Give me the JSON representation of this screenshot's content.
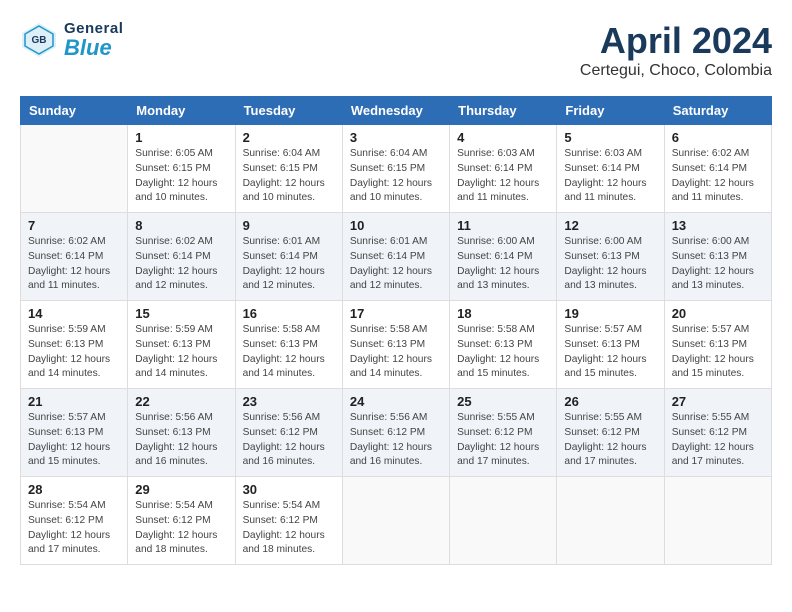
{
  "header": {
    "logo_general": "General",
    "logo_blue": "Blue",
    "month_title": "April 2024",
    "location": "Certegui, Choco, Colombia"
  },
  "calendar": {
    "days_of_week": [
      "Sunday",
      "Monday",
      "Tuesday",
      "Wednesday",
      "Thursday",
      "Friday",
      "Saturday"
    ],
    "weeks": [
      [
        {
          "day": "",
          "info": ""
        },
        {
          "day": "1",
          "info": "Sunrise: 6:05 AM\nSunset: 6:15 PM\nDaylight: 12 hours\nand 10 minutes."
        },
        {
          "day": "2",
          "info": "Sunrise: 6:04 AM\nSunset: 6:15 PM\nDaylight: 12 hours\nand 10 minutes."
        },
        {
          "day": "3",
          "info": "Sunrise: 6:04 AM\nSunset: 6:15 PM\nDaylight: 12 hours\nand 10 minutes."
        },
        {
          "day": "4",
          "info": "Sunrise: 6:03 AM\nSunset: 6:14 PM\nDaylight: 12 hours\nand 11 minutes."
        },
        {
          "day": "5",
          "info": "Sunrise: 6:03 AM\nSunset: 6:14 PM\nDaylight: 12 hours\nand 11 minutes."
        },
        {
          "day": "6",
          "info": "Sunrise: 6:02 AM\nSunset: 6:14 PM\nDaylight: 12 hours\nand 11 minutes."
        }
      ],
      [
        {
          "day": "7",
          "info": "Sunrise: 6:02 AM\nSunset: 6:14 PM\nDaylight: 12 hours\nand 11 minutes."
        },
        {
          "day": "8",
          "info": "Sunrise: 6:02 AM\nSunset: 6:14 PM\nDaylight: 12 hours\nand 12 minutes."
        },
        {
          "day": "9",
          "info": "Sunrise: 6:01 AM\nSunset: 6:14 PM\nDaylight: 12 hours\nand 12 minutes."
        },
        {
          "day": "10",
          "info": "Sunrise: 6:01 AM\nSunset: 6:14 PM\nDaylight: 12 hours\nand 12 minutes."
        },
        {
          "day": "11",
          "info": "Sunrise: 6:00 AM\nSunset: 6:14 PM\nDaylight: 12 hours\nand 13 minutes."
        },
        {
          "day": "12",
          "info": "Sunrise: 6:00 AM\nSunset: 6:13 PM\nDaylight: 12 hours\nand 13 minutes."
        },
        {
          "day": "13",
          "info": "Sunrise: 6:00 AM\nSunset: 6:13 PM\nDaylight: 12 hours\nand 13 minutes."
        }
      ],
      [
        {
          "day": "14",
          "info": "Sunrise: 5:59 AM\nSunset: 6:13 PM\nDaylight: 12 hours\nand 14 minutes."
        },
        {
          "day": "15",
          "info": "Sunrise: 5:59 AM\nSunset: 6:13 PM\nDaylight: 12 hours\nand 14 minutes."
        },
        {
          "day": "16",
          "info": "Sunrise: 5:58 AM\nSunset: 6:13 PM\nDaylight: 12 hours\nand 14 minutes."
        },
        {
          "day": "17",
          "info": "Sunrise: 5:58 AM\nSunset: 6:13 PM\nDaylight: 12 hours\nand 14 minutes."
        },
        {
          "day": "18",
          "info": "Sunrise: 5:58 AM\nSunset: 6:13 PM\nDaylight: 12 hours\nand 15 minutes."
        },
        {
          "day": "19",
          "info": "Sunrise: 5:57 AM\nSunset: 6:13 PM\nDaylight: 12 hours\nand 15 minutes."
        },
        {
          "day": "20",
          "info": "Sunrise: 5:57 AM\nSunset: 6:13 PM\nDaylight: 12 hours\nand 15 minutes."
        }
      ],
      [
        {
          "day": "21",
          "info": "Sunrise: 5:57 AM\nSunset: 6:13 PM\nDaylight: 12 hours\nand 15 minutes."
        },
        {
          "day": "22",
          "info": "Sunrise: 5:56 AM\nSunset: 6:13 PM\nDaylight: 12 hours\nand 16 minutes."
        },
        {
          "day": "23",
          "info": "Sunrise: 5:56 AM\nSunset: 6:12 PM\nDaylight: 12 hours\nand 16 minutes."
        },
        {
          "day": "24",
          "info": "Sunrise: 5:56 AM\nSunset: 6:12 PM\nDaylight: 12 hours\nand 16 minutes."
        },
        {
          "day": "25",
          "info": "Sunrise: 5:55 AM\nSunset: 6:12 PM\nDaylight: 12 hours\nand 17 minutes."
        },
        {
          "day": "26",
          "info": "Sunrise: 5:55 AM\nSunset: 6:12 PM\nDaylight: 12 hours\nand 17 minutes."
        },
        {
          "day": "27",
          "info": "Sunrise: 5:55 AM\nSunset: 6:12 PM\nDaylight: 12 hours\nand 17 minutes."
        }
      ],
      [
        {
          "day": "28",
          "info": "Sunrise: 5:54 AM\nSunset: 6:12 PM\nDaylight: 12 hours\nand 17 minutes."
        },
        {
          "day": "29",
          "info": "Sunrise: 5:54 AM\nSunset: 6:12 PM\nDaylight: 12 hours\nand 18 minutes."
        },
        {
          "day": "30",
          "info": "Sunrise: 5:54 AM\nSunset: 6:12 PM\nDaylight: 12 hours\nand 18 minutes."
        },
        {
          "day": "",
          "info": ""
        },
        {
          "day": "",
          "info": ""
        },
        {
          "day": "",
          "info": ""
        },
        {
          "day": "",
          "info": ""
        }
      ]
    ]
  }
}
